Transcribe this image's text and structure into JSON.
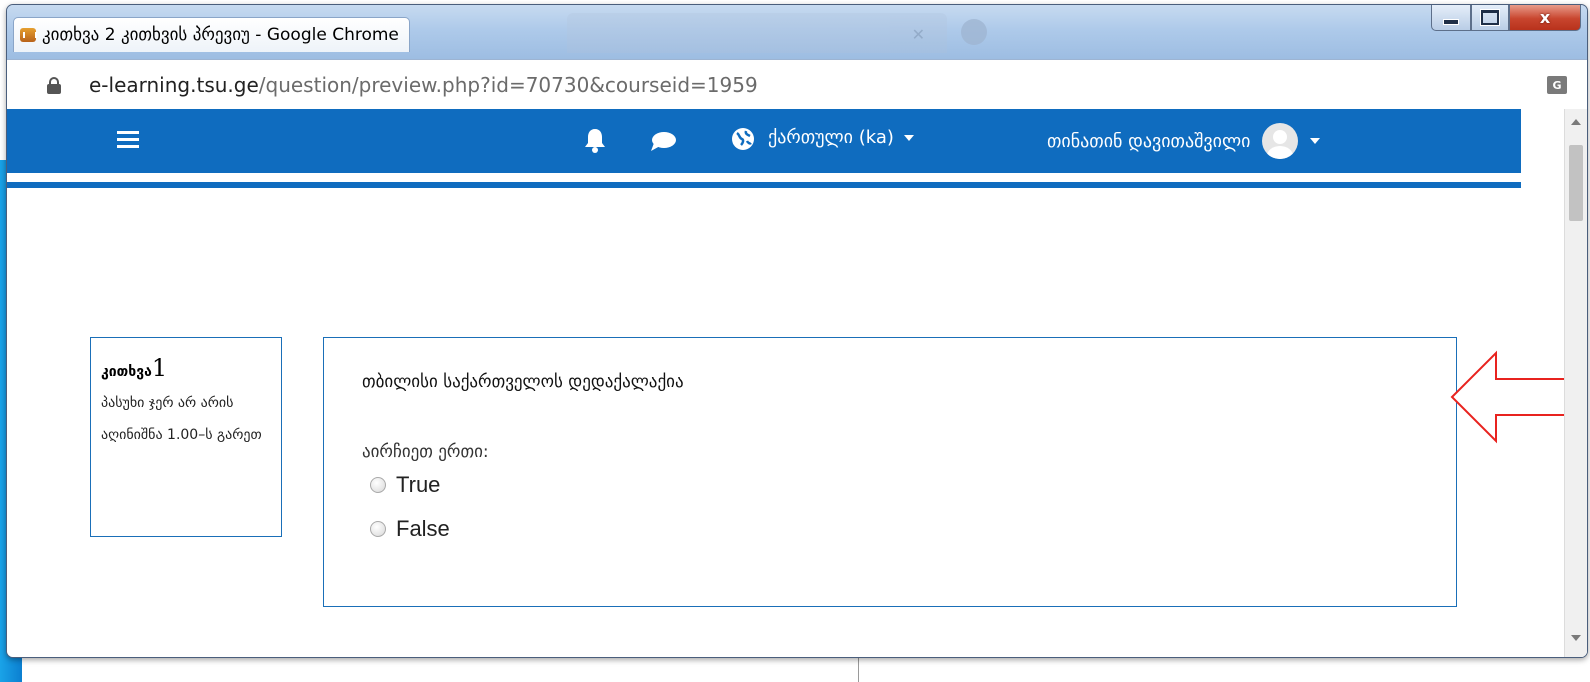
{
  "window": {
    "title": "კითხვა 2 კითხვის პრევიუ - Google Chrome",
    "close_label": "x"
  },
  "address_bar": {
    "url_host": "e-learning.tsu.ge",
    "url_path": "/question/preview.php?id=70730&courseid=1959"
  },
  "navbar": {
    "language": "ქართული (ka)",
    "user_name": "თინათინ დავითაშვილი"
  },
  "question_info": {
    "title": "კითხვა",
    "number": "1",
    "state": "პასუხი ჯერ არ არის",
    "grade": "აღინიშნა 1.00–ს გარეთ"
  },
  "question": {
    "text": "თბილისი საქართველოს დედაქალაქია",
    "prompt": "აირჩიეთ ერთი:",
    "options": [
      "True",
      "False"
    ]
  },
  "colors": {
    "navbar": "#0f6cbf",
    "box_border": "#1a6fb8",
    "arrow": "#e8231f"
  }
}
